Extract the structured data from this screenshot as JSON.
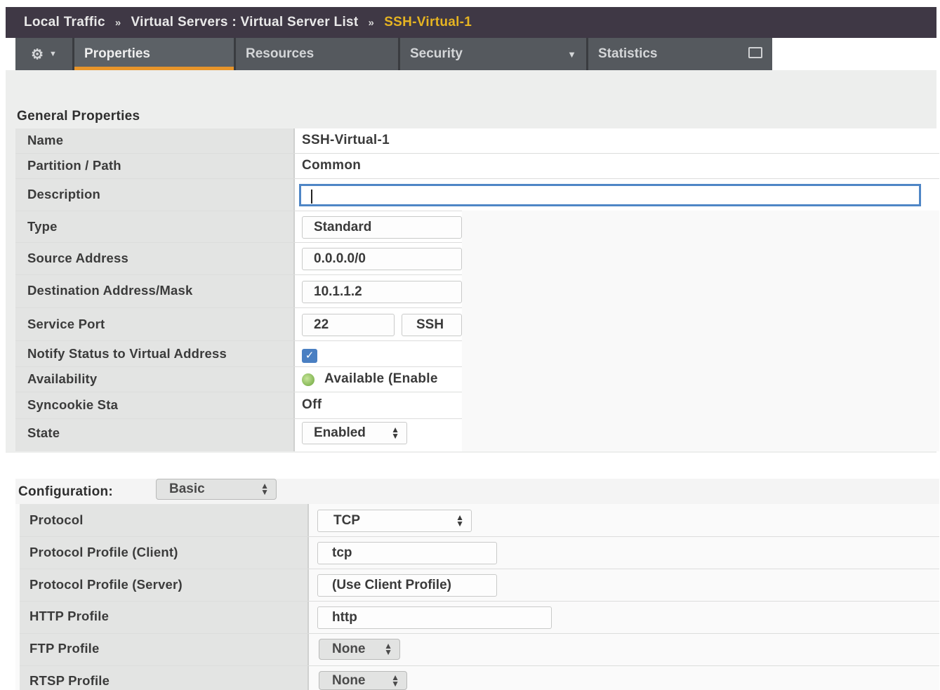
{
  "breadcrumb": {
    "part1": "Local Traffic",
    "sep": "»",
    "part2": "Virtual Servers : Virtual Server List",
    "current": "SSH-Virtual-1"
  },
  "tabs": {
    "gear": "⚙",
    "properties": "Properties",
    "resources": "Resources",
    "security": "Security",
    "statistics": "Statistics"
  },
  "general": {
    "title": "General Properties",
    "rows": [
      {
        "label": "Name",
        "value": "SSH-Virtual-1"
      },
      {
        "label": "Partition / Path",
        "value": "Common"
      },
      {
        "label": "Description",
        "value": ""
      },
      {
        "label": "Type",
        "value": "Standard"
      },
      {
        "label": "Source Address",
        "value": "0.0.0.0/0"
      },
      {
        "label": "Destination Address/Mask",
        "value": "10.1.1.2"
      },
      {
        "label": "Service Port",
        "value": "22",
        "extra": "SSH"
      },
      {
        "label": "Notify Status to Virtual Address",
        "value": "checked"
      },
      {
        "label": "Availability",
        "value": "Available (Enable"
      },
      {
        "label": "Syncookie Sta",
        "value": "Off"
      },
      {
        "label": "State",
        "value": "Enabled"
      }
    ]
  },
  "configuration": {
    "title": "Configuration:",
    "mode": "Basic",
    "rows": [
      {
        "label": "Protocol",
        "value": "TCP"
      },
      {
        "label": "Protocol Profile (Client)",
        "value": "tcp"
      },
      {
        "label": "Protocol Profile (Server)",
        "value": "(Use Client Profile)"
      },
      {
        "label": "HTTP Profile",
        "value": "http"
      },
      {
        "label": "FTP Profile",
        "value": "None"
      },
      {
        "label": "RTSP Profile",
        "value": "None"
      }
    ]
  },
  "colors": {
    "header_bg": "#3f3845",
    "breadcrumb_current": "#e6b422",
    "active_tab_underline": "#e8952a",
    "focus_border": "#4f86c6"
  }
}
